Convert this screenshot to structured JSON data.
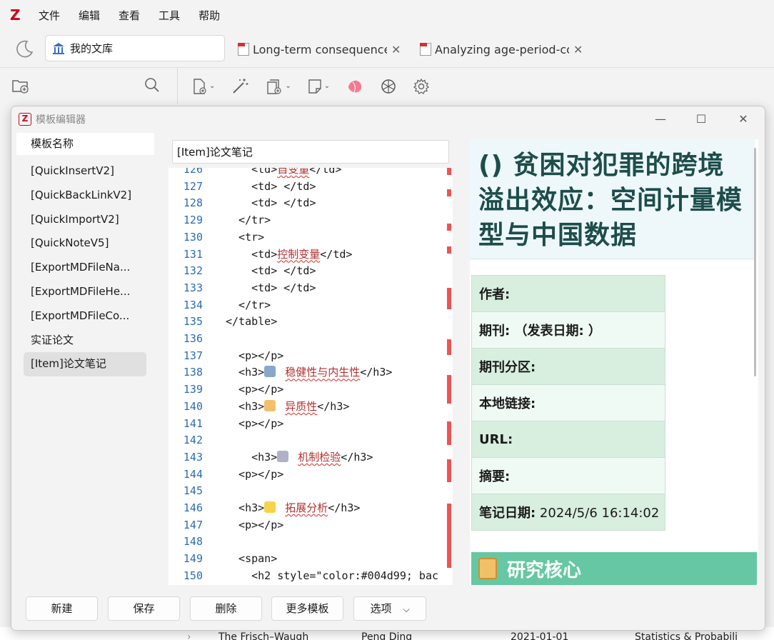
{
  "menubar": {
    "logo": "Z",
    "items": [
      "文件",
      "编辑",
      "查看",
      "工具",
      "帮助"
    ]
  },
  "tabs": {
    "library": "我的文库",
    "docs": [
      {
        "title": "Long-term consequence"
      },
      {
        "title": "Analyzing age-period-co"
      }
    ]
  },
  "bottom_row": {
    "title": "The Frisch–Waugh",
    "author": "Peng Ding",
    "date": "2021-01-01",
    "subject": "Statistics & Probabili"
  },
  "dialog": {
    "title": "模板编辑器",
    "template_header": "模板名称",
    "templates": [
      "[QuickInsertV2]",
      "[QuickBackLinkV2]",
      "[QuickImportV2]",
      "[QuickNoteV5]",
      "[ExportMDFileNa...",
      "[ExportMDFileHe...",
      "[ExportMDFileCo...",
      "实证论文",
      "[Item]论文笔记"
    ],
    "selected_template": "[Item]论文笔记",
    "name_input_value": "[Item]论文笔记",
    "buttons": {
      "new": "新建",
      "save": "保存",
      "delete": "删除",
      "more": "更多模板",
      "options": "选项"
    }
  },
  "code_lines": [
    {
      "n": "126",
      "pre": "    <td>",
      "cn": "自变量",
      "post": "</td>"
    },
    {
      "n": "127",
      "pre": "    <td> </td>"
    },
    {
      "n": "128",
      "pre": "    <td> </td>"
    },
    {
      "n": "129",
      "pre": "  </tr>"
    },
    {
      "n": "130",
      "pre": "  <tr>"
    },
    {
      "n": "131",
      "pre": "    <td>",
      "cn": "控制变量",
      "post": "</td>"
    },
    {
      "n": "132",
      "pre": "    <td> </td>"
    },
    {
      "n": "133",
      "pre": "    <td> </td>"
    },
    {
      "n": "134",
      "pre": "  </tr>"
    },
    {
      "n": "135",
      "pre": "</table>"
    },
    {
      "n": "136",
      "pre": ""
    },
    {
      "n": "137",
      "pre": "  <p></p>"
    },
    {
      "n": "138",
      "pre": "  <h3>",
      "cn": "稳健性与内生性",
      "post": "</h3>",
      "emoji": "#8aa6c9"
    },
    {
      "n": "139",
      "pre": "  <p></p>"
    },
    {
      "n": "140",
      "pre": "  <h3>",
      "cn": "异质性",
      "post": "</h3>",
      "emoji": "#f3c06a"
    },
    {
      "n": "141",
      "pre": "  <p></p>"
    },
    {
      "n": "142",
      "pre": ""
    },
    {
      "n": "143",
      "pre": "    <h3>",
      "cn": "机制检验",
      "post": "</h3>",
      "emoji": "#b0b0c8"
    },
    {
      "n": "144",
      "pre": "  <p></p>"
    },
    {
      "n": "145",
      "pre": ""
    },
    {
      "n": "146",
      "pre": "  <h3>",
      "cn": "拓展分析",
      "post": "</h3>",
      "emoji": "#f7d34a"
    },
    {
      "n": "147",
      "pre": "  <p></p>"
    },
    {
      "n": "148",
      "pre": ""
    },
    {
      "n": "149",
      "pre": "  <span>"
    },
    {
      "n": "150",
      "pre": "    <h2 style=\"color:#004d99; bac"
    }
  ],
  "preview": {
    "title": "() 贫困对犯罪的跨境溢出效应：空间计量模型与中国数据",
    "rows": [
      {
        "label": "作者:",
        "value": ""
      },
      {
        "label": "期刊: （发表日期: ）",
        "value": ""
      },
      {
        "label": "期刊分区:",
        "value": ""
      },
      {
        "label": "本地链接:",
        "value": ""
      },
      {
        "label": "URL:",
        "value": ""
      },
      {
        "label": "摘要:",
        "value": ""
      },
      {
        "label": "笔记日期:",
        "value": " 2024/5/6 16:14:02"
      }
    ],
    "section_heading": "研究核心"
  }
}
